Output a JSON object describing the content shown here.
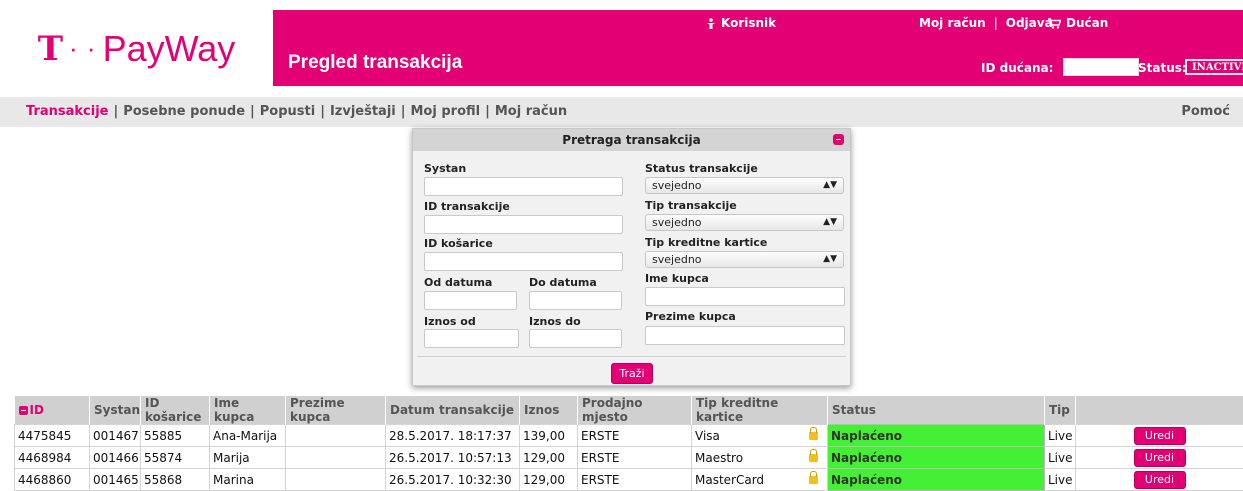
{
  "brand": {
    "t_letter": "T",
    "dots": "· ·",
    "name": "PayWay"
  },
  "header": {
    "page_title": "Pregled transakcija",
    "user_link": "Korisnik",
    "my_account": "Moj račun",
    "logout": "Odjava",
    "shop_link": "Dućan",
    "shop_id_label": "ID dućana:",
    "shop_id_value": "",
    "status_label": "Status:",
    "status_value": "INACTIVE"
  },
  "nav": {
    "items": [
      "Transakcije",
      "Posebne ponude",
      "Popusti",
      "Izvještaji",
      "Moj profil",
      "Moj račun"
    ],
    "help": "Pomoć"
  },
  "search": {
    "title": "Pretraga transakcija",
    "systan_label": "Systan",
    "transaction_id_label": "ID transakcije",
    "cart_id_label": "ID košarice",
    "date_from_label": "Od datuma",
    "date_to_label": "Do datuma",
    "amount_from_label": "Iznos od",
    "amount_to_label": "Iznos do",
    "status_label": "Status transakcije",
    "status_value": "svejedno",
    "type_label": "Tip transakcije",
    "type_value": "svejedno",
    "card_type_label": "Tip kreditne kartice",
    "card_type_value": "svejedno",
    "first_name_label": "Ime kupca",
    "last_name_label": "Prezime kupca",
    "submit_label": "Traži"
  },
  "table": {
    "columns": [
      "ID",
      "Systan",
      "ID košarice",
      "Ime kupca",
      "Prezime kupca",
      "Datum transakcije",
      "Iznos",
      "Prodajno mjesto",
      "Tip kreditne kartice",
      "Status",
      "Tip",
      ""
    ],
    "edit_label": "Uredi",
    "rows": [
      {
        "id": "4475845",
        "systan": "001467",
        "cart": "55885",
        "first": "Ana-Marija",
        "last": "",
        "date": "28.5.2017. 18:17:37",
        "amount": "139,00",
        "pos": "ERSTE",
        "card": "Visa",
        "status": "Naplaćeno",
        "type": "Live"
      },
      {
        "id": "4468984",
        "systan": "001466",
        "cart": "55874",
        "first": "Marija",
        "last": "",
        "date": "26.5.2017. 10:57:13",
        "amount": "129,00",
        "pos": "ERSTE",
        "card": "Maestro",
        "status": "Naplaćeno",
        "type": "Live"
      },
      {
        "id": "4468860",
        "systan": "001465",
        "cart": "55868",
        "first": "Marina",
        "last": "",
        "date": "26.5.2017. 10:32:30",
        "amount": "129,00",
        "pos": "ERSTE",
        "card": "MasterCard",
        "status": "Naplaćeno",
        "type": "Live"
      }
    ]
  },
  "colors": {
    "brand": "#e20074",
    "paid": "#44f033",
    "nav_bg": "#e8e8e8",
    "table_header": "#d0d0d0"
  }
}
